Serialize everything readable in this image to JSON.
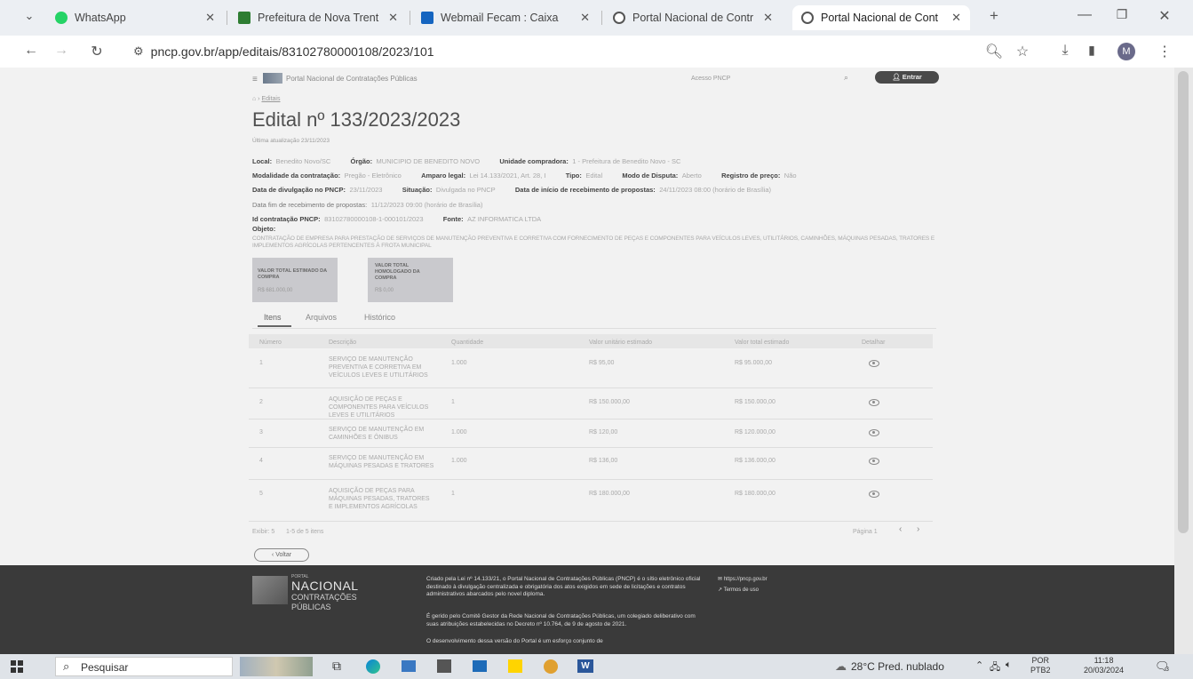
{
  "browser": {
    "tabs": [
      {
        "label": "WhatsApp",
        "color": "#25d366"
      },
      {
        "label": "Prefeitura de Nova Trent",
        "color": "#2e7d32"
      },
      {
        "label": "Webmail Fecam : Caixa",
        "color": "#1565c0"
      },
      {
        "label": "Portal Nacional de Contr",
        "color": "#555555"
      },
      {
        "label": "Portal Nacional de Cont",
        "color": "#555555"
      }
    ],
    "url": "pncp.gov.br/app/editais/83102780000108/2023/101",
    "profile_initial": "M"
  },
  "site": {
    "brand": "Portal Nacional de Contratações Públicas",
    "header_link": "Acesso PNCP",
    "login_label": "Entrar"
  },
  "page": {
    "breadcrumb": "Editais",
    "title": "Edital nº 133/2023/2023",
    "updated": "Última atualização 23/11/2023",
    "fields": {
      "local_label": "Local:",
      "local_value": "Benedito Novo/SC",
      "orgao_label": "Órgão:",
      "orgao_value": "MUNICIPIO DE BENEDITO NOVO",
      "unidade_label": "Unidade compradora:",
      "unidade_value": "1 - Prefeitura de Benedito Novo - SC",
      "modalidade_label": "Modalidade da contratação:",
      "modalidade_value": "Pregão - Eletrônico",
      "amparo_label": "Amparo legal:",
      "amparo_value": "Lei 14.133/2021, Art. 28, I",
      "tipo_label": "Tipo:",
      "tipo_value": "Edital",
      "disputa_label": "Modo de Disputa:",
      "disputa_value": "Aberto",
      "registro_label": "Registro de preço:",
      "registro_value": "Não",
      "divulgacao_label": "Data de divulgação no PNCP:",
      "divulgacao_value": "23/11/2023",
      "situacao_label": "Situação:",
      "situacao_value": "Divulgada no PNCP",
      "inicio_label": "Data de início de recebimento de propostas:",
      "inicio_value": "24/11/2023 08:00 (horário de Brasília)",
      "fim_label": "Data fim de recebimento de propostas:",
      "fim_value": "11/12/2023 09:00 (horário de Brasília)",
      "id_label": "Id contratação PNCP:",
      "id_value": "83102780000108-1-000101/2023",
      "fonte_label": "Fonte:",
      "fonte_value": "AZ INFORMATICA LTDA",
      "objeto_label": "Objeto:",
      "objeto_value": "CONTRATAÇÃO DE EMPRESA PARA PRESTAÇÃO DE SERVIÇOS DE MANUTENÇÃO PREVENTIVA E CORRETIVA COM FORNECIMENTO DE PEÇAS E COMPONENTES PARA VEÍCULOS LEVES, UTILITÁRIOS, CAMINHÕES, MÁQUINAS PESADAS, TRATORES E IMPLEMENTOS AGRÍCOLAS PERTENCENTES À FROTA MUNICIPAL"
    },
    "cards": [
      {
        "label": "VALOR TOTAL ESTIMADO DA COMPRA",
        "value": "R$ 681.000,00"
      },
      {
        "label": "VALOR TOTAL HOMOLOGADO DA COMPRA",
        "value": "R$ 0,00"
      }
    ],
    "tabs": [
      "Itens",
      "Arquivos",
      "Histórico"
    ],
    "table": {
      "headers": [
        "Número",
        "Descrição",
        "Quantidade",
        "Valor unitário estimado",
        "Valor total estimado",
        "Detalhar"
      ],
      "rows": [
        {
          "num": "1",
          "desc": "SERVIÇO DE MANUTENÇÃO PREVENTIVA E CORRETIVA EM VEÍCULOS LEVES E UTILITÁRIOS",
          "qty": "1.000",
          "unit": "R$ 95,00",
          "total": "R$ 95.000,00"
        },
        {
          "num": "2",
          "desc": "AQUISIÇÃO DE PEÇAS E COMPONENTES PARA VEÍCULOS LEVES E UTILITÁRIOS",
          "qty": "1",
          "unit": "R$ 150.000,00",
          "total": "R$ 150.000,00"
        },
        {
          "num": "3",
          "desc": "SERVIÇO DE MANUTENÇÃO EM CAMINHÕES E ÔNIBUS",
          "qty": "1.000",
          "unit": "R$ 120,00",
          "total": "R$ 120.000,00"
        },
        {
          "num": "4",
          "desc": "SERVIÇO DE MANUTENÇÃO EM MÁQUINAS PESADAS E TRATORES",
          "qty": "1.000",
          "unit": "R$ 136,00",
          "total": "R$ 136.000,00"
        },
        {
          "num": "5",
          "desc": "AQUISIÇÃO DE PEÇAS PARA MÁQUINAS PESADAS, TRATORES E IMPLEMENTOS AGRÍCOLAS",
          "qty": "1",
          "unit": "R$ 180.000,00",
          "total": "R$ 180.000,00"
        }
      ],
      "footer_left": "Exibir: 5",
      "footer_count": "1-5 de 5 itens",
      "footer_page": "Página 1"
    },
    "back_label": "Voltar"
  },
  "footer": {
    "logo_line1": "PORTAL",
    "logo_line2": "NACIONAL",
    "logo_line3": "CONTRATAÇÕES",
    "logo_line4": "PÚBLICAS",
    "p1": "Criado pela Lei nº 14.133/21, o Portal Nacional de Contratações Públicas (PNCP) é o sítio eletrônico oficial destinado à divulgação centralizada e obrigatória dos atos exigidos em sede de licitações e contratos administrativos abarcados pelo novel diploma.",
    "p2": "É gerido pelo Comitê Gestor da Rede Nacional de Contratações Públicas, um colegiado deliberativo com suas atribuições estabelecidas no Decreto nº 10.764, de 9 de agosto de 2021.",
    "p3": "O desenvolvimento dessa versão do Portal é um esforço conjunto de",
    "link1": "https://pncp.gov.br",
    "link2": "Termos de uso"
  },
  "taskbar": {
    "search_placeholder": "Pesquisar",
    "weather": "28°C  Pred. nublado",
    "lang1": "POR",
    "lang2": "PTB2",
    "time": "11:18",
    "date": "20/03/2024",
    "notif_count": "3"
  }
}
